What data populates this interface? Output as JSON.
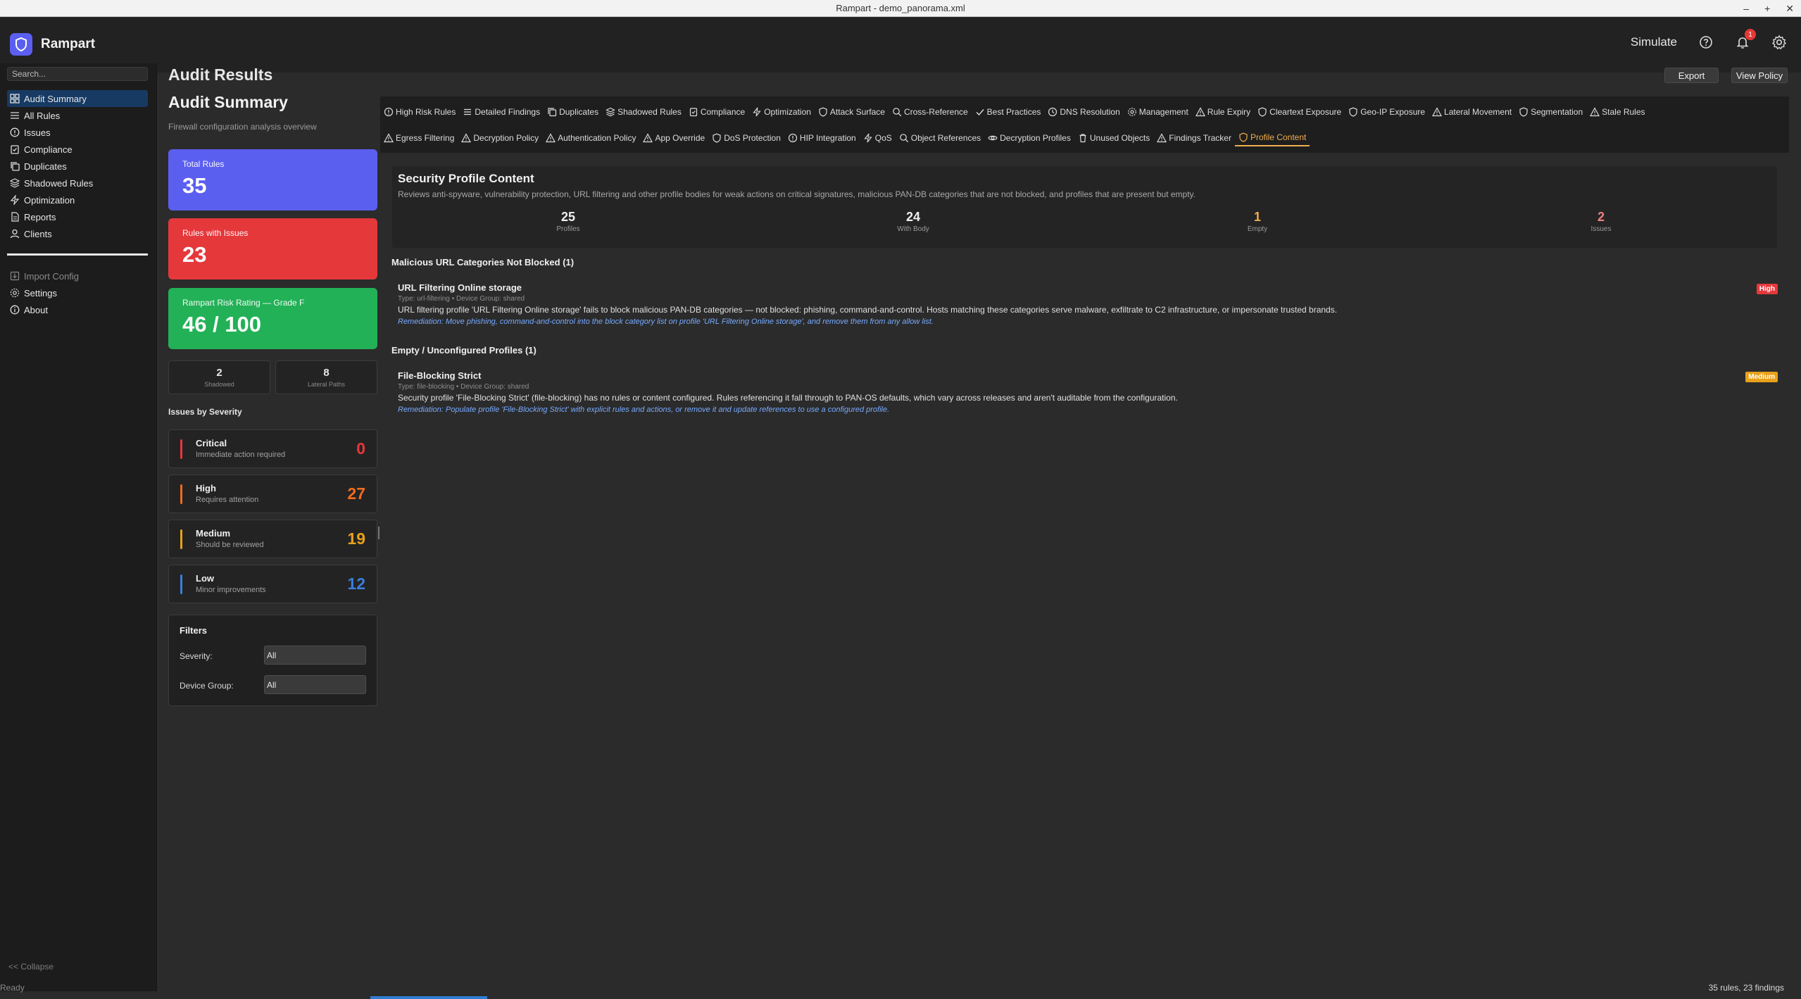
{
  "window": {
    "title": "Rampart - demo_panorama.xml",
    "controls": [
      "–",
      "+",
      "✕"
    ]
  },
  "app": {
    "name": "Rampart",
    "simulate_label": "Simulate",
    "notification_count": "1",
    "brand_color": "#5b5ff0"
  },
  "sidebar": {
    "search_placeholder": "Search...",
    "items": [
      {
        "label": "Audit Summary",
        "icon": "grid-icon",
        "active": true
      },
      {
        "label": "All Rules",
        "icon": "list-icon"
      },
      {
        "label": "Issues",
        "icon": "alert-circle-icon"
      },
      {
        "label": "Compliance",
        "icon": "clipboard-check-icon"
      },
      {
        "label": "Duplicates",
        "icon": "copy-icon"
      },
      {
        "label": "Shadowed Rules",
        "icon": "layers-icon"
      },
      {
        "label": "Optimization",
        "icon": "zap-icon"
      },
      {
        "label": "Reports",
        "icon": "file-icon"
      },
      {
        "label": "Clients",
        "icon": "user-icon"
      }
    ],
    "secondary": [
      {
        "label": "Import Config",
        "icon": "import-icon"
      },
      {
        "label": "Settings",
        "icon": "gear-icon"
      },
      {
        "label": "About",
        "icon": "info-icon"
      }
    ],
    "collapse_label": "<< Collapse"
  },
  "main": {
    "title": "Audit Results",
    "export_label": "Export",
    "view_policy_label": "View Policy"
  },
  "summary": {
    "title": "Audit Summary",
    "subtitle": "Firewall configuration analysis overview",
    "cards": {
      "total": {
        "label": "Total Rules",
        "value": "35"
      },
      "issues": {
        "label": "Rules with Issues",
        "value": "23"
      },
      "risk": {
        "label": "Rampart Risk Rating — Grade F",
        "value": "46 / 100"
      }
    },
    "mini": {
      "shadowed": {
        "value": "2",
        "label": "Shadowed"
      },
      "lateral": {
        "value": "8",
        "label": "Lateral Paths"
      }
    },
    "severity_heading": "Issues by Severity",
    "severities": [
      {
        "name": "Critical",
        "desc": "Immediate action required",
        "count": "0",
        "color": "#e5383b"
      },
      {
        "name": "High",
        "desc": "Requires attention",
        "count": "27",
        "color": "#f26b1d"
      },
      {
        "name": "Medium",
        "desc": "Should be reviewed",
        "count": "19",
        "color": "#e8a11a"
      },
      {
        "name": "Low",
        "desc": "Minor improvements",
        "count": "12",
        "color": "#3b7ddd"
      }
    ],
    "filters": {
      "title": "Filters",
      "severity_label": "Severity:",
      "severity_value": "All",
      "group_label": "Device Group:",
      "group_value": "All"
    }
  },
  "tabs": {
    "row1": [
      {
        "label": "High Risk Rules",
        "icon": "alert-circle-icon"
      },
      {
        "label": "Detailed Findings",
        "icon": "list-icon"
      },
      {
        "label": "Duplicates",
        "icon": "copy-icon"
      },
      {
        "label": "Shadowed Rules",
        "icon": "layers-icon"
      },
      {
        "label": "Compliance",
        "icon": "clipboard-check-icon"
      },
      {
        "label": "Optimization",
        "icon": "zap-icon"
      },
      {
        "label": "Attack Surface",
        "icon": "shield-icon"
      },
      {
        "label": "Cross-Reference",
        "icon": "search-icon"
      },
      {
        "label": "Best Practices",
        "icon": "check-icon"
      },
      {
        "label": "DNS Resolution",
        "icon": "clock-icon"
      },
      {
        "label": "Management",
        "icon": "gear-icon"
      },
      {
        "label": "Rule Expiry",
        "icon": "triangle-icon"
      },
      {
        "label": "Cleartext Exposure",
        "icon": "shield-icon"
      },
      {
        "label": "Geo-IP Exposure",
        "icon": "shield-icon"
      },
      {
        "label": "Lateral Movement",
        "icon": "triangle-icon"
      },
      {
        "label": "Segmentation",
        "icon": "shield-icon"
      },
      {
        "label": "Stale Rules",
        "icon": "triangle-icon"
      }
    ],
    "row2": [
      {
        "label": "Egress Filtering",
        "icon": "triangle-icon"
      },
      {
        "label": "Decryption Policy",
        "icon": "triangle-icon"
      },
      {
        "label": "Authentication Policy",
        "icon": "triangle-icon"
      },
      {
        "label": "App Override",
        "icon": "triangle-icon"
      },
      {
        "label": "DoS Protection",
        "icon": "shield-icon"
      },
      {
        "label": "HIP Integration",
        "icon": "alert-circle-icon"
      },
      {
        "label": "QoS",
        "icon": "zap-icon"
      },
      {
        "label": "Object References",
        "icon": "search-icon"
      },
      {
        "label": "Decryption Profiles",
        "icon": "eye-icon"
      },
      {
        "label": "Unused Objects",
        "icon": "trash-icon"
      },
      {
        "label": "Findings Tracker",
        "icon": "triangle-icon"
      },
      {
        "label": "Profile Content",
        "icon": "shield-icon",
        "active": true
      }
    ]
  },
  "content": {
    "title": "Security Profile Content",
    "description": "Reviews anti-spyware, vulnerability protection, URL filtering and other profile bodies for weak actions on critical signatures, malicious PAN-DB categories that are not blocked, and profiles that are present but empty.",
    "stats": [
      {
        "value": "25",
        "label": "Profiles",
        "color": "#f0f0f0"
      },
      {
        "value": "24",
        "label": "With Body",
        "color": "#f0f0f0"
      },
      {
        "value": "1",
        "label": "Empty",
        "color": "#f0ad4e"
      },
      {
        "value": "2",
        "label": "Issues",
        "color": "#f08080"
      }
    ],
    "sections": [
      {
        "title": "Malicious URL Categories Not Blocked (1)",
        "finding": {
          "name": "URL Filtering Online storage",
          "type": "Type: url-filtering • Device Group: shared",
          "desc": "URL filtering profile 'URL Filtering Online storage' fails to block malicious PAN-DB categories — not blocked: phishing, command-and-control. Hosts matching these categories serve malware, exfiltrate to C2 infrastructure, or impersonate trusted brands.",
          "remediation": "Remediation: Move phishing, command-and-control into the block category list on profile 'URL Filtering Online storage', and remove them from any allow list.",
          "badge": "High",
          "badge_color": "#e5383b"
        }
      },
      {
        "title": "Empty / Unconfigured Profiles (1)",
        "finding": {
          "name": "File-Blocking Strict",
          "type": "Type: file-blocking • Device Group: shared",
          "desc": "Security profile 'File-Blocking Strict' (file-blocking) has no rules or content configured. Rules referencing it fall through to PAN-OS defaults, which vary across releases and aren't auditable from the configuration.",
          "remediation": "Remediation: Populate profile 'File-Blocking Strict' with explicit rules and actions, or remove it and update references to use a configured profile.",
          "badge": "Medium",
          "badge_color": "#e8a11a"
        }
      }
    ]
  },
  "status": {
    "left": "Ready",
    "right": "35 rules, 23 findings"
  }
}
